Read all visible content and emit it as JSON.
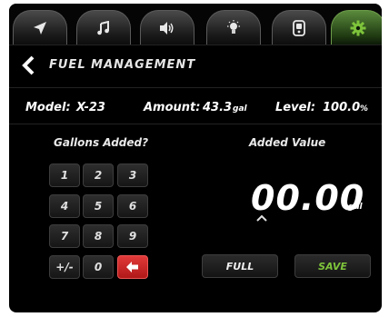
{
  "tabs": [
    {
      "icon": "navigation-arrow-icon",
      "active": false
    },
    {
      "icon": "music-note-icon",
      "active": false
    },
    {
      "icon": "speaker-volume-icon",
      "active": false
    },
    {
      "icon": "light-bulb-icon",
      "active": false
    },
    {
      "icon": "device-remote-icon",
      "active": false
    },
    {
      "icon": "gear-icon",
      "active": true
    }
  ],
  "header": {
    "back_icon": "chevron-left-icon",
    "title": "FUEL MANAGEMENT"
  },
  "info": {
    "model_label": "Model:",
    "model_value": "X-23",
    "amount_label": "Amount:",
    "amount_value": "43.3",
    "amount_unit": "gal",
    "level_label": "Level:",
    "level_value": "100.0",
    "level_unit": "%"
  },
  "keypad": {
    "title": "Gallons Added?",
    "keys": [
      "1",
      "2",
      "3",
      "4",
      "5",
      "6",
      "7",
      "8",
      "9",
      "+/-",
      "0"
    ],
    "delete_icon": "backspace-arrow-icon"
  },
  "added": {
    "title": "Added Value",
    "value": "00.00",
    "unit": "gal",
    "caret_icon": "caret-up-icon"
  },
  "buttons": {
    "full_label": "FULL",
    "save_label": "SAVE"
  },
  "colors": {
    "accent_green": "#7ec43b",
    "delete_red": "#d42a2a",
    "background": "#000000"
  }
}
